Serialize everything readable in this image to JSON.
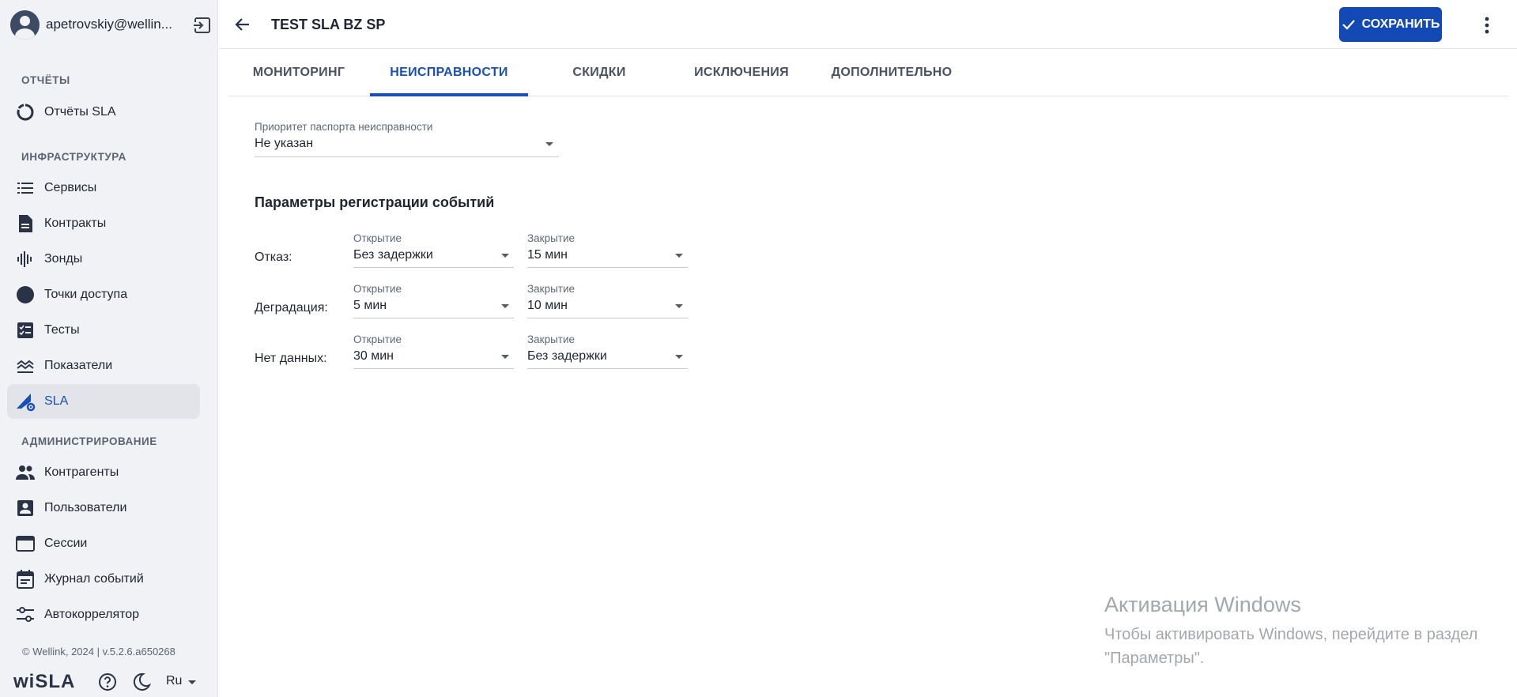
{
  "user": {
    "email": "apetrovskiy@wellin..."
  },
  "sidebar": {
    "sections": [
      {
        "title": "ОТЧЁТЫ"
      },
      {
        "title": "ИНФРАСТРУКТУРА"
      },
      {
        "title": "АДМИНИСТРИРОВАНИЕ"
      }
    ],
    "items": [
      {
        "label": "Отчёты SLA",
        "icon": "report-icon"
      },
      {
        "label": "Сервисы",
        "icon": "list-icon"
      },
      {
        "label": "Контракты",
        "icon": "document-icon"
      },
      {
        "label": "Зонды",
        "icon": "probe-icon"
      },
      {
        "label": "Точки доступа",
        "icon": "circle-icon"
      },
      {
        "label": "Тесты",
        "icon": "checklist-icon"
      },
      {
        "label": "Показатели",
        "icon": "metrics-icon"
      },
      {
        "label": "SLA",
        "icon": "sla-icon",
        "active": true
      },
      {
        "label": "Контрагенты",
        "icon": "people-icon"
      },
      {
        "label": "Пользователи",
        "icon": "user-card-icon"
      },
      {
        "label": "Сессии",
        "icon": "window-icon"
      },
      {
        "label": "Журнал событий",
        "icon": "calendar-icon"
      },
      {
        "label": "Автокоррелятор",
        "icon": "sliders-icon"
      }
    ],
    "footer": {
      "copyright": "© Wellink, 2024 | v.5.2.6.a650268",
      "brand": "wiSLA",
      "language": "Ru"
    }
  },
  "header": {
    "title": "TEST SLA BZ SP",
    "save_label": "СОХРАНИТЬ"
  },
  "tabs": [
    {
      "label": "МОНИТОРИНГ"
    },
    {
      "label": "НЕИСПРАВНОСТИ",
      "active": true
    },
    {
      "label": "СКИДКИ"
    },
    {
      "label": "ИСКЛЮЧЕНИЯ"
    },
    {
      "label": "ДОПОЛНИТЕЛЬНО"
    }
  ],
  "form": {
    "priority": {
      "label": "Приоритет паспорта неисправности",
      "value": "Не указан"
    },
    "section_title": "Параметры регистрации событий",
    "open_label": "Открытие",
    "close_label": "Закрытие",
    "rows": [
      {
        "label": "Отказ:",
        "open": "Без задержки",
        "close": "15 мин"
      },
      {
        "label": "Деградация:",
        "open": "5 мин",
        "close": "10 мин"
      },
      {
        "label": "Нет данных:",
        "open": "30 мин",
        "close": "Без задержки"
      }
    ]
  },
  "watermark": {
    "title": "Активация Windows",
    "text": "Чтобы активировать Windows, перейдите в раздел \"Параметры\"."
  },
  "colors": {
    "accent": "#1a4fb3",
    "button": "#1249b5",
    "sidebar_bg": "#f1f2f5"
  }
}
